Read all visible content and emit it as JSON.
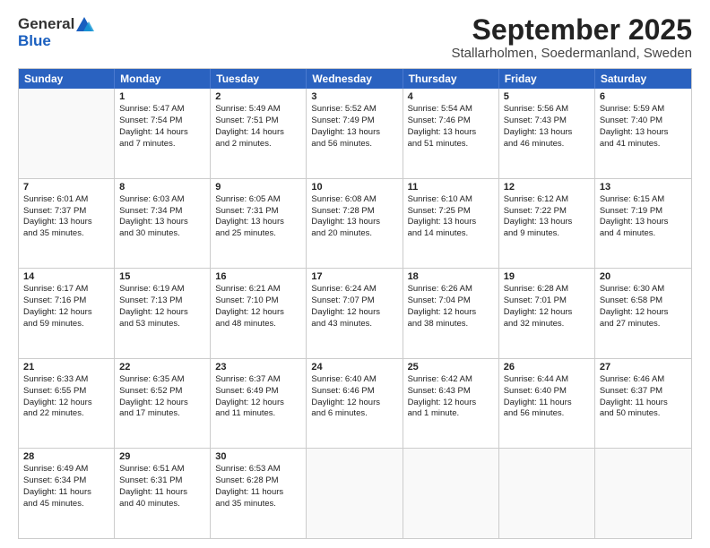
{
  "logo": {
    "general": "General",
    "blue": "Blue"
  },
  "title": "September 2025",
  "location": "Stallarholmen, Soedermanland, Sweden",
  "header_days": [
    "Sunday",
    "Monday",
    "Tuesday",
    "Wednesday",
    "Thursday",
    "Friday",
    "Saturday"
  ],
  "weeks": [
    [
      {
        "day": "",
        "lines": []
      },
      {
        "day": "1",
        "lines": [
          "Sunrise: 5:47 AM",
          "Sunset: 7:54 PM",
          "Daylight: 14 hours",
          "and 7 minutes."
        ]
      },
      {
        "day": "2",
        "lines": [
          "Sunrise: 5:49 AM",
          "Sunset: 7:51 PM",
          "Daylight: 14 hours",
          "and 2 minutes."
        ]
      },
      {
        "day": "3",
        "lines": [
          "Sunrise: 5:52 AM",
          "Sunset: 7:49 PM",
          "Daylight: 13 hours",
          "and 56 minutes."
        ]
      },
      {
        "day": "4",
        "lines": [
          "Sunrise: 5:54 AM",
          "Sunset: 7:46 PM",
          "Daylight: 13 hours",
          "and 51 minutes."
        ]
      },
      {
        "day": "5",
        "lines": [
          "Sunrise: 5:56 AM",
          "Sunset: 7:43 PM",
          "Daylight: 13 hours",
          "and 46 minutes."
        ]
      },
      {
        "day": "6",
        "lines": [
          "Sunrise: 5:59 AM",
          "Sunset: 7:40 PM",
          "Daylight: 13 hours",
          "and 41 minutes."
        ]
      }
    ],
    [
      {
        "day": "7",
        "lines": [
          "Sunrise: 6:01 AM",
          "Sunset: 7:37 PM",
          "Daylight: 13 hours",
          "and 35 minutes."
        ]
      },
      {
        "day": "8",
        "lines": [
          "Sunrise: 6:03 AM",
          "Sunset: 7:34 PM",
          "Daylight: 13 hours",
          "and 30 minutes."
        ]
      },
      {
        "day": "9",
        "lines": [
          "Sunrise: 6:05 AM",
          "Sunset: 7:31 PM",
          "Daylight: 13 hours",
          "and 25 minutes."
        ]
      },
      {
        "day": "10",
        "lines": [
          "Sunrise: 6:08 AM",
          "Sunset: 7:28 PM",
          "Daylight: 13 hours",
          "and 20 minutes."
        ]
      },
      {
        "day": "11",
        "lines": [
          "Sunrise: 6:10 AM",
          "Sunset: 7:25 PM",
          "Daylight: 13 hours",
          "and 14 minutes."
        ]
      },
      {
        "day": "12",
        "lines": [
          "Sunrise: 6:12 AM",
          "Sunset: 7:22 PM",
          "Daylight: 13 hours",
          "and 9 minutes."
        ]
      },
      {
        "day": "13",
        "lines": [
          "Sunrise: 6:15 AM",
          "Sunset: 7:19 PM",
          "Daylight: 13 hours",
          "and 4 minutes."
        ]
      }
    ],
    [
      {
        "day": "14",
        "lines": [
          "Sunrise: 6:17 AM",
          "Sunset: 7:16 PM",
          "Daylight: 12 hours",
          "and 59 minutes."
        ]
      },
      {
        "day": "15",
        "lines": [
          "Sunrise: 6:19 AM",
          "Sunset: 7:13 PM",
          "Daylight: 12 hours",
          "and 53 minutes."
        ]
      },
      {
        "day": "16",
        "lines": [
          "Sunrise: 6:21 AM",
          "Sunset: 7:10 PM",
          "Daylight: 12 hours",
          "and 48 minutes."
        ]
      },
      {
        "day": "17",
        "lines": [
          "Sunrise: 6:24 AM",
          "Sunset: 7:07 PM",
          "Daylight: 12 hours",
          "and 43 minutes."
        ]
      },
      {
        "day": "18",
        "lines": [
          "Sunrise: 6:26 AM",
          "Sunset: 7:04 PM",
          "Daylight: 12 hours",
          "and 38 minutes."
        ]
      },
      {
        "day": "19",
        "lines": [
          "Sunrise: 6:28 AM",
          "Sunset: 7:01 PM",
          "Daylight: 12 hours",
          "and 32 minutes."
        ]
      },
      {
        "day": "20",
        "lines": [
          "Sunrise: 6:30 AM",
          "Sunset: 6:58 PM",
          "Daylight: 12 hours",
          "and 27 minutes."
        ]
      }
    ],
    [
      {
        "day": "21",
        "lines": [
          "Sunrise: 6:33 AM",
          "Sunset: 6:55 PM",
          "Daylight: 12 hours",
          "and 22 minutes."
        ]
      },
      {
        "day": "22",
        "lines": [
          "Sunrise: 6:35 AM",
          "Sunset: 6:52 PM",
          "Daylight: 12 hours",
          "and 17 minutes."
        ]
      },
      {
        "day": "23",
        "lines": [
          "Sunrise: 6:37 AM",
          "Sunset: 6:49 PM",
          "Daylight: 12 hours",
          "and 11 minutes."
        ]
      },
      {
        "day": "24",
        "lines": [
          "Sunrise: 6:40 AM",
          "Sunset: 6:46 PM",
          "Daylight: 12 hours",
          "and 6 minutes."
        ]
      },
      {
        "day": "25",
        "lines": [
          "Sunrise: 6:42 AM",
          "Sunset: 6:43 PM",
          "Daylight: 12 hours",
          "and 1 minute."
        ]
      },
      {
        "day": "26",
        "lines": [
          "Sunrise: 6:44 AM",
          "Sunset: 6:40 PM",
          "Daylight: 11 hours",
          "and 56 minutes."
        ]
      },
      {
        "day": "27",
        "lines": [
          "Sunrise: 6:46 AM",
          "Sunset: 6:37 PM",
          "Daylight: 11 hours",
          "and 50 minutes."
        ]
      }
    ],
    [
      {
        "day": "28",
        "lines": [
          "Sunrise: 6:49 AM",
          "Sunset: 6:34 PM",
          "Daylight: 11 hours",
          "and 45 minutes."
        ]
      },
      {
        "day": "29",
        "lines": [
          "Sunrise: 6:51 AM",
          "Sunset: 6:31 PM",
          "Daylight: 11 hours",
          "and 40 minutes."
        ]
      },
      {
        "day": "30",
        "lines": [
          "Sunrise: 6:53 AM",
          "Sunset: 6:28 PM",
          "Daylight: 11 hours",
          "and 35 minutes."
        ]
      },
      {
        "day": "",
        "lines": []
      },
      {
        "day": "",
        "lines": []
      },
      {
        "day": "",
        "lines": []
      },
      {
        "day": "",
        "lines": []
      }
    ]
  ]
}
